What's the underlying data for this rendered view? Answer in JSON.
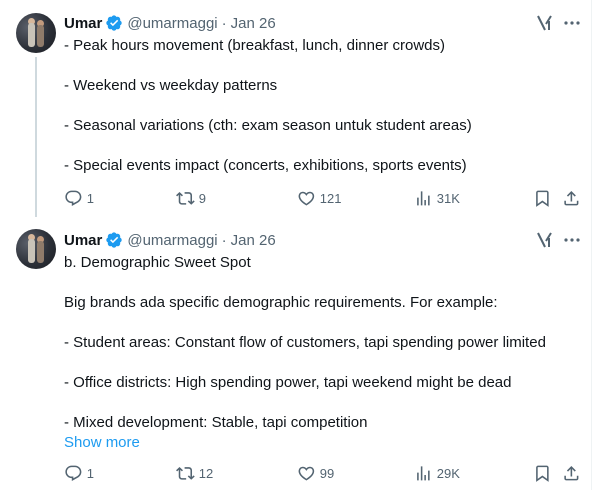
{
  "tweets": [
    {
      "author_name": "Umar",
      "handle": "@umarmaggi",
      "separator": "·",
      "date": "Jan 26",
      "lines": [
        "- Peak hours movement (breakfast, lunch, dinner crowds)",
        "",
        "- Weekend vs weekday patterns",
        "",
        "- Seasonal variations (cth: exam season untuk student areas)",
        "",
        "- Special events impact (concerts, exhibitions, sports events)"
      ],
      "show_more": "",
      "stats": {
        "replies": "1",
        "reposts": "9",
        "likes": "121",
        "views": "31K"
      }
    },
    {
      "author_name": "Umar",
      "handle": "@umarmaggi",
      "separator": "·",
      "date": "Jan 26",
      "lines": [
        "b. Demographic Sweet Spot",
        "",
        "Big brands ada specific demographic requirements. For example:",
        "",
        "- Student areas: Constant flow of customers, tapi spending power limited",
        "",
        "- Office districts: High spending power, tapi weekend might be dead",
        "",
        "- Mixed development: Stable, tapi competition"
      ],
      "show_more": "Show more",
      "stats": {
        "replies": "1",
        "reposts": "12",
        "likes": "99",
        "views": "29K"
      }
    }
  ],
  "icons": {
    "verified": "verified-badge-icon",
    "grok": "grok-icon",
    "more": "more-icon",
    "reply": "reply-icon",
    "repost": "repost-icon",
    "like": "heart-icon",
    "views": "views-icon",
    "bookmark": "bookmark-icon",
    "share": "share-icon"
  },
  "colors": {
    "text": "#0f1419",
    "secondary": "#536471",
    "link": "#1d9bf0",
    "verified": "#1d9bf0",
    "thread_line": "#cfd9de"
  }
}
